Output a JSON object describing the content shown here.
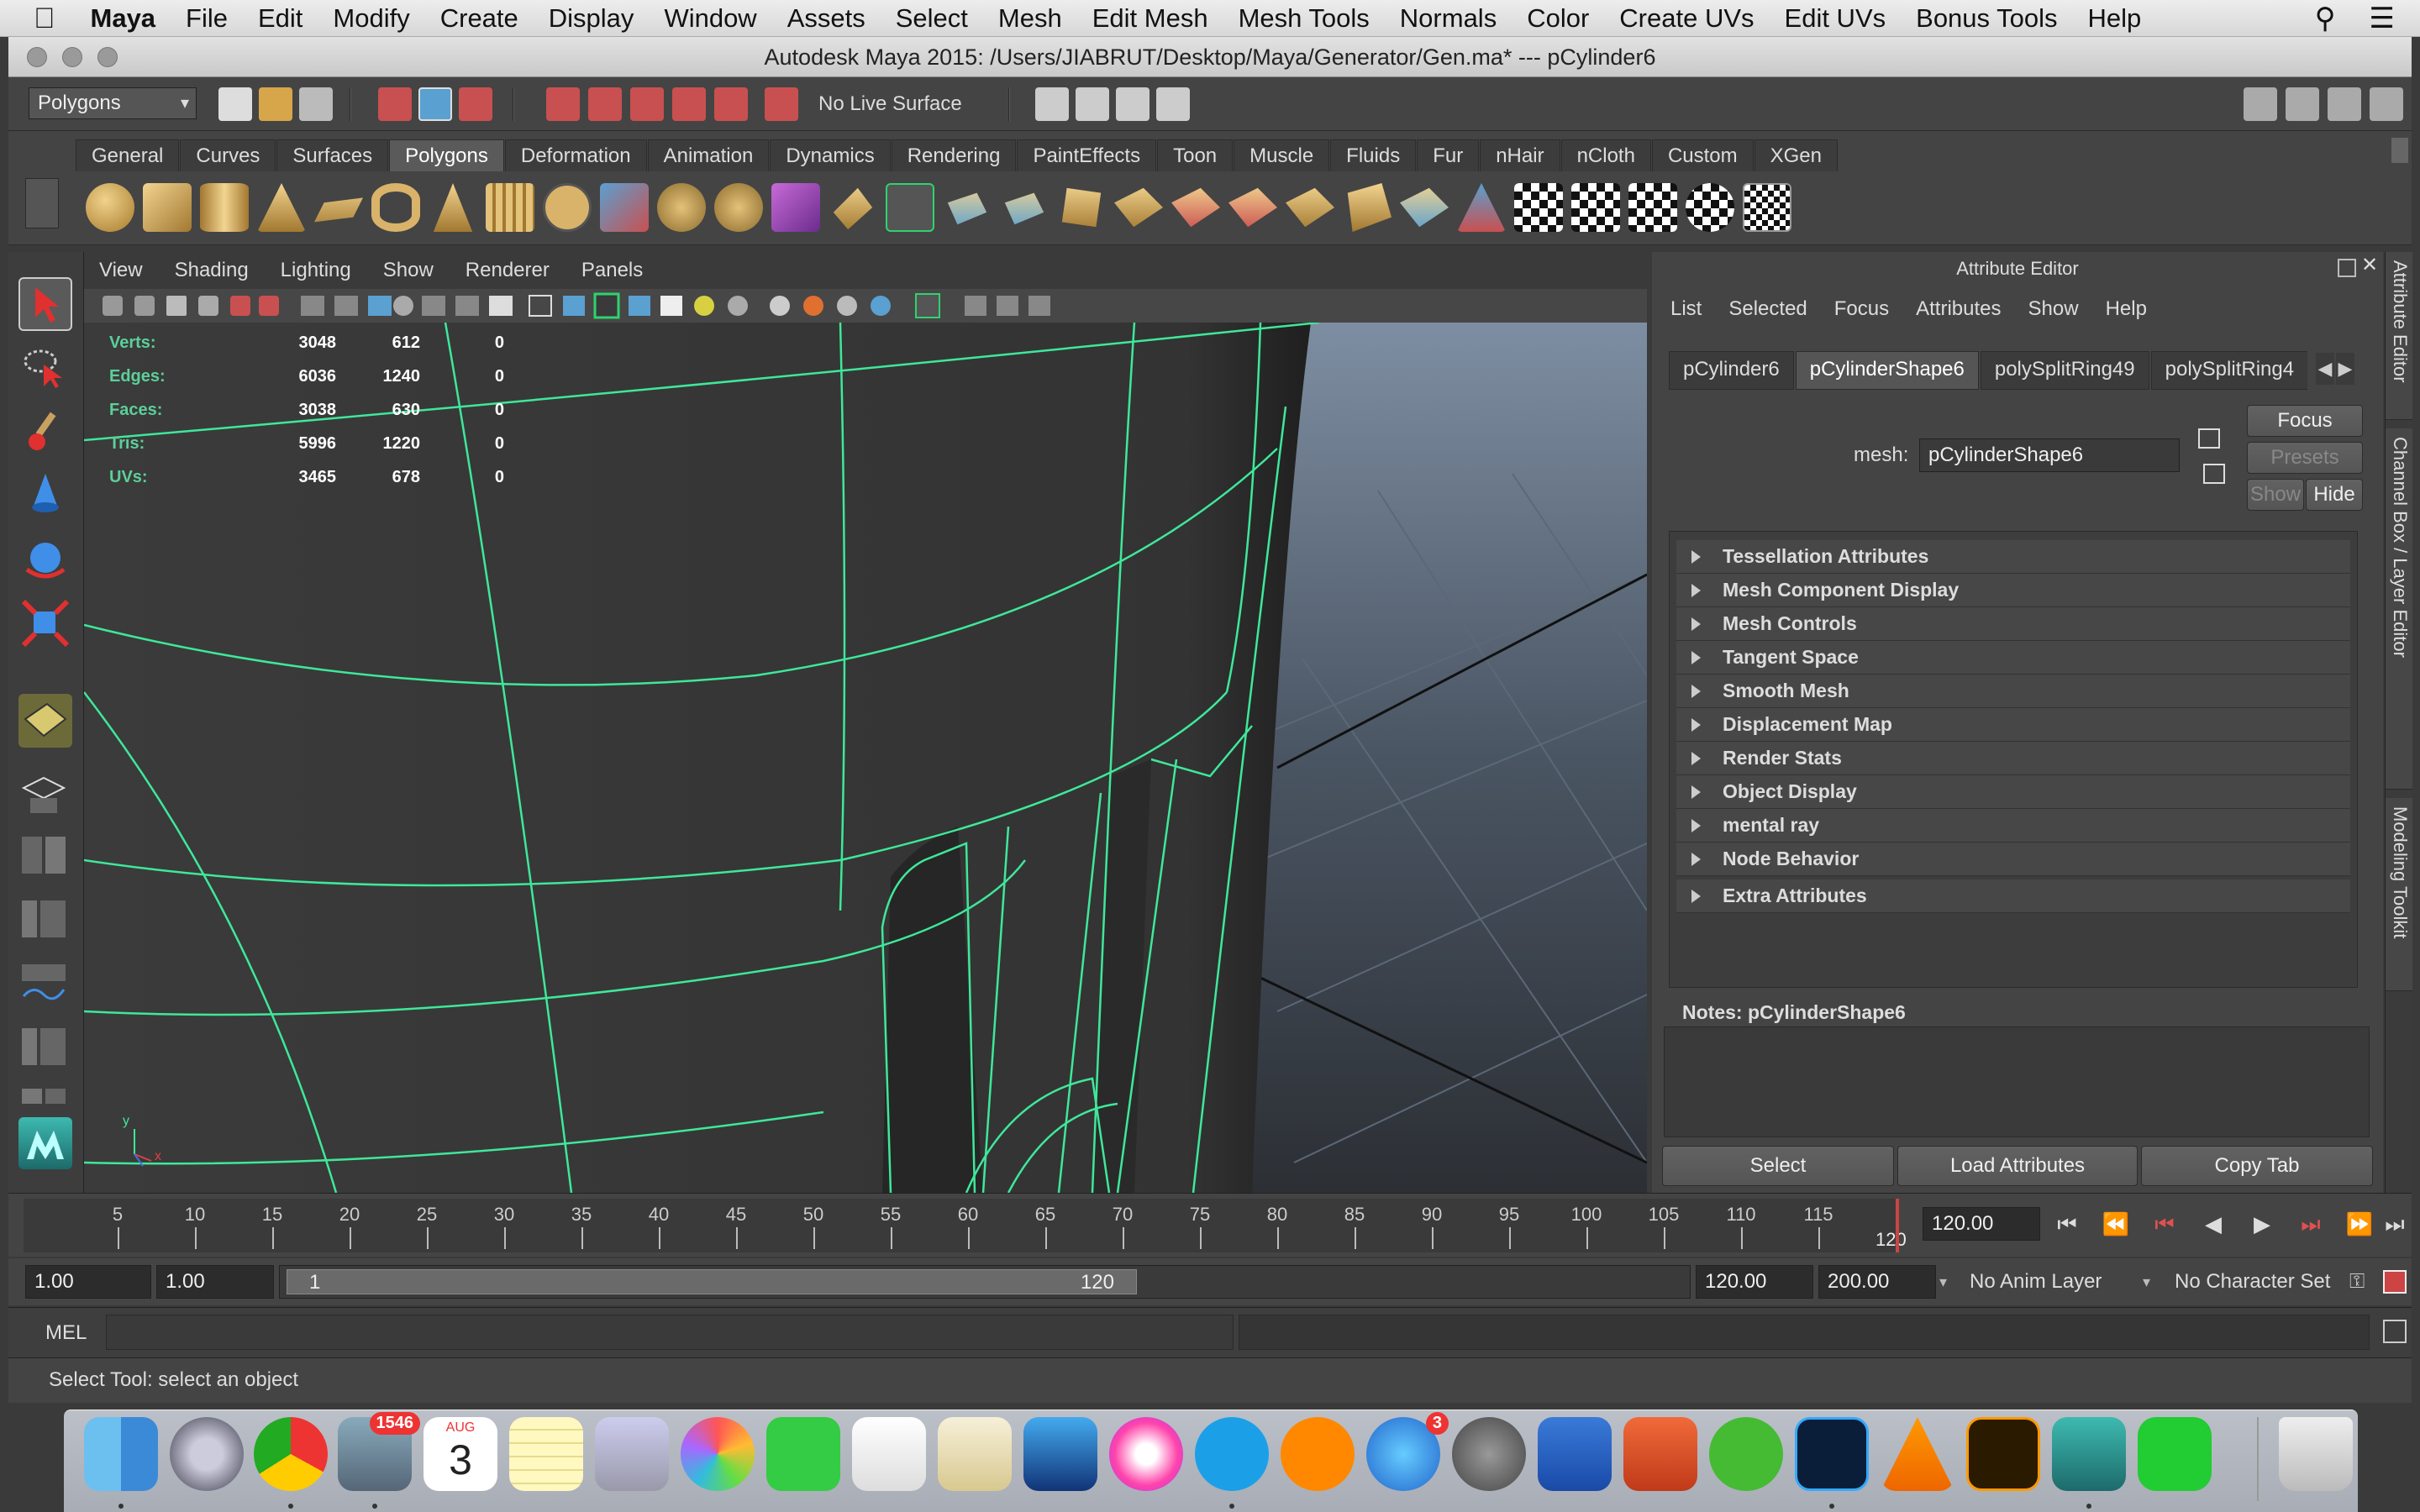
{
  "menubar": {
    "apple": "",
    "items": [
      "Maya",
      "File",
      "Edit",
      "Modify",
      "Create",
      "Display",
      "Window",
      "Assets",
      "Select",
      "Mesh",
      "Edit Mesh",
      "Mesh Tools",
      "Normals",
      "Color",
      "Create UVs",
      "Edit UVs",
      "Bonus Tools",
      "Help"
    ]
  },
  "window": {
    "title": "Autodesk Maya 2015: /Users/JIABRUT/Desktop/Maya/Generator/Gen.ma*   ---   pCylinder6"
  },
  "statusline": {
    "menuset": "Polygons",
    "live_surface": "No Live Surface"
  },
  "shelf": {
    "tabs": [
      "General",
      "Curves",
      "Surfaces",
      "Polygons",
      "Deformation",
      "Animation",
      "Dynamics",
      "Rendering",
      "PaintEffects",
      "Toon",
      "Muscle",
      "Fluids",
      "Fur",
      "nHair",
      "nCloth",
      "Custom",
      "XGen"
    ],
    "active_tab": "Polygons"
  },
  "viewport": {
    "menu": [
      "View",
      "Shading",
      "Lighting",
      "Show",
      "Renderer",
      "Panels"
    ],
    "hud": {
      "rows": [
        {
          "label": "Verts:",
          "v1": "3048",
          "v2": "612",
          "v3": "0"
        },
        {
          "label": "Edges:",
          "v1": "6036",
          "v2": "1240",
          "v3": "0"
        },
        {
          "label": "Faces:",
          "v1": "3038",
          "v2": "630",
          "v3": "0"
        },
        {
          "label": "Tris:",
          "v1": "5996",
          "v2": "1220",
          "v3": "0"
        },
        {
          "label": "UVs:",
          "v1": "3465",
          "v2": "678",
          "v3": "0"
        }
      ]
    },
    "axis": {
      "x": "x",
      "y": "y"
    },
    "colors": {
      "wire": "#3ee89a",
      "bg_dark": "#3c3c3c",
      "grid_bg": "#4d5a6a"
    }
  },
  "attribute_editor": {
    "title": "Attribute Editor",
    "menu": [
      "List",
      "Selected",
      "Focus",
      "Attributes",
      "Show",
      "Help"
    ],
    "tabs": [
      "pCylinder6",
      "pCylinderShape6",
      "polySplitRing49",
      "polySplitRing4"
    ],
    "active_tab": "pCylinderShape6",
    "mesh_label": "mesh:",
    "mesh_value": "pCylinderShape6",
    "buttons": {
      "focus": "Focus",
      "presets": "Presets",
      "show": "Show",
      "hide": "Hide"
    },
    "sections": [
      "Tessellation Attributes",
      "Mesh Component Display",
      "Mesh Controls",
      "Tangent Space",
      "Smooth Mesh",
      "Displacement Map",
      "Render Stats",
      "Object Display",
      "mental ray",
      "Node Behavior",
      "Extra Attributes"
    ],
    "notes_label": "Notes:  pCylinderShape6",
    "bottom_buttons": {
      "select": "Select",
      "load": "Load Attributes",
      "copy": "Copy Tab"
    }
  },
  "side_tabs": [
    "Attribute Editor",
    "Channel Box / Layer Editor",
    "Modeling Toolkit"
  ],
  "timeslider": {
    "ticks": [
      "5",
      "10",
      "15",
      "20",
      "25",
      "30",
      "35",
      "40",
      "45",
      "50",
      "55",
      "60",
      "65",
      "70",
      "75",
      "80",
      "85",
      "90",
      "95",
      "100",
      "105",
      "110",
      "115"
    ],
    "end_tick": "120",
    "current_frame": "120.00"
  },
  "rangeslider": {
    "start": "1.00",
    "playback_start": "1.00",
    "range_min": "1",
    "range_max": "120",
    "playback_end": "120.00",
    "end": "200.00",
    "anim_layer": "No Anim Layer",
    "character_set": "No Character Set"
  },
  "commandline": {
    "label": "MEL"
  },
  "helpline": {
    "text": "Select Tool: select an object"
  },
  "dock": {
    "badges": {
      "mail": "1546",
      "appstore": "3"
    },
    "calendar_month": "AUG",
    "calendar_day": "3"
  }
}
